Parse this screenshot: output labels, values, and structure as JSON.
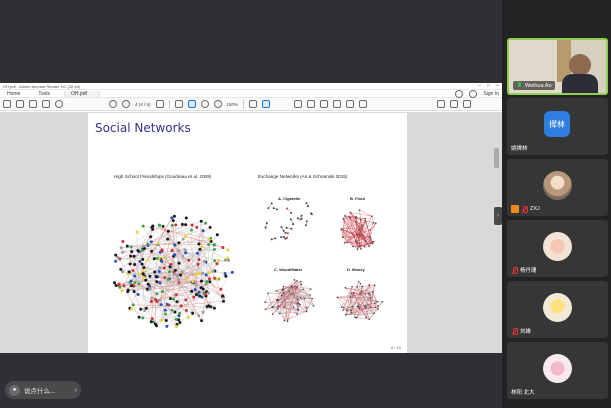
{
  "acrobat": {
    "window_title": "OH.pdf - Adobe Acrobat Reader DC (32-bit)",
    "menu": {
      "home": "Home",
      "tools": "Tools",
      "doc_tab": "OH.pdf"
    },
    "sign_in": "Sign In",
    "page_indicator": "4 (4 / 6)",
    "zoom": "150%"
  },
  "slide": {
    "title": "Social Networks",
    "left_caption": "High School Friendships (Goodreau et al. 2009)",
    "right_caption": "Exchange Networks (An & Schramski 2015)",
    "panels": [
      "A. Cigarette",
      "B. Food",
      "C. Wood/Water",
      "D. Money"
    ],
    "page_number": "8 / 20"
  },
  "bottom_bar": {
    "chat_placeholder": "说点什么...",
    "expand_label": "‹"
  },
  "participants": [
    {
      "name": "Weihua An",
      "type": "video",
      "muted": false
    },
    {
      "name": "姚撵林",
      "type": "initials",
      "initials": "撵林",
      "muted": false
    },
    {
      "name": "ZXJ",
      "type": "avatar",
      "muted": true,
      "badge": true
    },
    {
      "name": "杨丹珊",
      "type": "avatar",
      "muted": true
    },
    {
      "name": "刘雄",
      "type": "avatar",
      "muted": true
    },
    {
      "name": "林阳 北大",
      "type": "avatar",
      "muted": false
    }
  ],
  "colors": {
    "slide_title": "#33338f",
    "active_speaker_border": "#8fd14f",
    "network_edge_red": "#c8323c",
    "initials_chip": "#2f7de1"
  },
  "icons": [
    "search-icon",
    "star-icon",
    "upload-icon",
    "print-icon",
    "zoom-icon",
    "select-cursor-icon",
    "hand-tool-icon",
    "zoom-out-icon",
    "zoom-in-icon",
    "fit-page-icon",
    "comment-icon",
    "highlight-icon",
    "pen-icon",
    "stamp-icon",
    "delete-icon",
    "share-icon",
    "help-icon",
    "bell-icon",
    "mic-muted-icon",
    "mic-icon"
  ]
}
